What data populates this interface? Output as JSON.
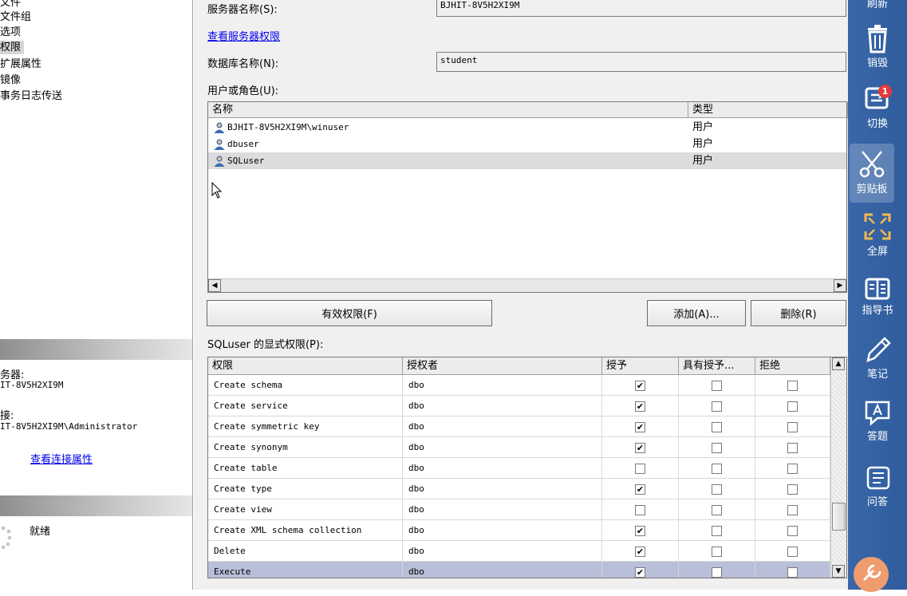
{
  "left_pane": {
    "pages": [
      "文件",
      "文件组",
      "选项",
      "权限",
      "扩展属性",
      "镜像",
      "事务日志传送"
    ],
    "selected_page_index": 3,
    "connection": {
      "server_label": "务器:",
      "server_value": "IT-8V5H2XI9M",
      "conn_label": "接:",
      "conn_value": "IT-8V5H2XI9M\\Administrator",
      "view_link": "查看连接属性"
    },
    "progress": {
      "status": "就绪"
    }
  },
  "main": {
    "server_label": "服务器名称(S):",
    "server_value": "BJHIT-8V5H2XI9M",
    "server_perm_link": "查看服务器权限",
    "db_label": "数据库名称(N):",
    "db_value": "student",
    "users_label": "用户或角色(U):",
    "users_columns": [
      "名称",
      "类型"
    ],
    "users": [
      {
        "name": "BJHIT-8V5H2XI9M\\winuser",
        "type": "用户"
      },
      {
        "name": "dbuser",
        "type": "用户"
      },
      {
        "name": "SQLuser",
        "type": "用户"
      }
    ],
    "selected_user_index": 2,
    "buttons": {
      "effective": "有效权限(F)",
      "add": "添加(A)...",
      "remove": "删除(R)"
    },
    "perm_label": "SQLuser 的显式权限(P):",
    "perm_columns": [
      "权限",
      "授权者",
      "授予",
      "具有授予...",
      "拒绝"
    ],
    "permissions": [
      {
        "name": "Create schema",
        "grantor": "dbo",
        "grant": true,
        "with_grant": false,
        "deny": false
      },
      {
        "name": "Create service",
        "grantor": "dbo",
        "grant": true,
        "with_grant": false,
        "deny": false
      },
      {
        "name": "Create symmetric key",
        "grantor": "dbo",
        "grant": true,
        "with_grant": false,
        "deny": false
      },
      {
        "name": "Create synonym",
        "grantor": "dbo",
        "grant": true,
        "with_grant": false,
        "deny": false
      },
      {
        "name": "Create table",
        "grantor": "dbo",
        "grant": false,
        "with_grant": false,
        "deny": false
      },
      {
        "name": "Create type",
        "grantor": "dbo",
        "grant": true,
        "with_grant": false,
        "deny": false
      },
      {
        "name": "Create view",
        "grantor": "dbo",
        "grant": false,
        "with_grant": false,
        "deny": false
      },
      {
        "name": "Create XML schema collection",
        "grantor": "dbo",
        "grant": true,
        "with_grant": false,
        "deny": false
      },
      {
        "name": "Delete",
        "grantor": "dbo",
        "grant": true,
        "with_grant": false,
        "deny": false
      },
      {
        "name": "Execute",
        "grantor": "dbo",
        "grant": true,
        "with_grant": false,
        "deny": false
      }
    ],
    "selected_perm_index": 9
  },
  "toolbar": {
    "items": [
      {
        "label": "刷新",
        "icon": "refresh-icon"
      },
      {
        "label": "销毁",
        "icon": "trash-icon"
      },
      {
        "label": "切换",
        "icon": "switch-icon",
        "badge": "1"
      },
      {
        "label": "剪贴板",
        "icon": "clipboard-icon"
      },
      {
        "label": "全屏",
        "icon": "fullscreen-icon"
      },
      {
        "label": "指导书",
        "icon": "book-icon"
      },
      {
        "label": "笔记",
        "icon": "pencil-icon"
      },
      {
        "label": "答题",
        "icon": "answer-icon"
      },
      {
        "label": "问答",
        "icon": "qa-icon"
      }
    ],
    "colors": {
      "bg": "#3a67a7",
      "badge": "#e23b3b",
      "accent": "#f0a070"
    }
  }
}
